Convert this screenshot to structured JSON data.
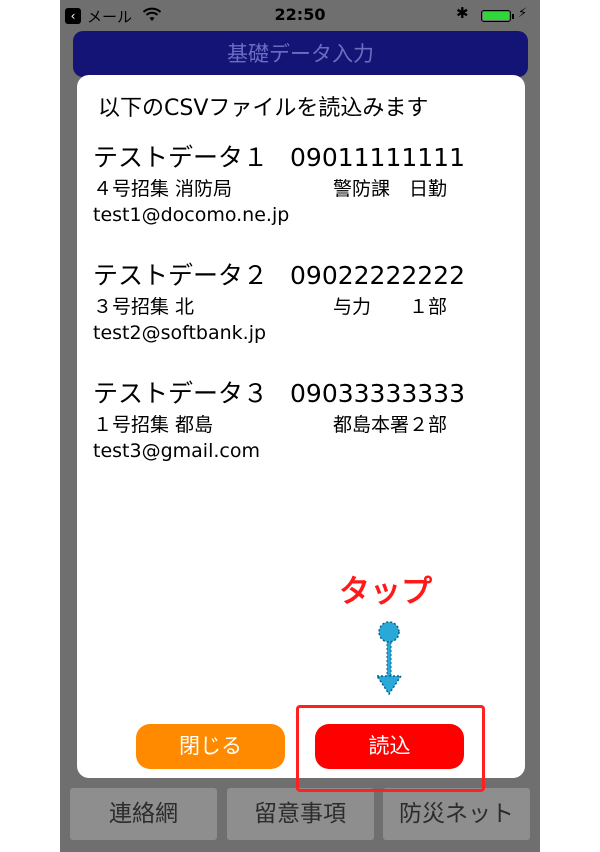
{
  "status_bar": {
    "back_glyph": "‹",
    "carrier": "メール",
    "time": "22:50",
    "bt_glyph": "✱",
    "charge_glyph": "⚡"
  },
  "app": {
    "title": "基礎データ入力",
    "bottom_tabs": [
      "連絡網",
      "留意事項",
      "防災ネット"
    ]
  },
  "dialog": {
    "title": "以下のCSVファイルを読込みます",
    "records": [
      {
        "name": "テストデータ１",
        "tel": "09011111111",
        "unit": "４号招集 消防局",
        "dept": "警防課　日勤",
        "email": "test1@docomo.ne.jp"
      },
      {
        "name": "テストデータ２",
        "tel": "09022222222",
        "unit": "３号招集 北",
        "dept": "与力　　１部",
        "email": "test2@softbank.jp"
      },
      {
        "name": "テストデータ３",
        "tel": "09033333333",
        "unit": "１号招集 都島",
        "dept": "都島本署２部",
        "email": "test3@gmail.com"
      }
    ],
    "close_label": "閉じる",
    "read_label": "読込"
  },
  "annotation": {
    "label": "タップ",
    "color": "#ff1a1a",
    "arrow_color": "#2aa8d8"
  },
  "colors": {
    "title_bar": "#141477",
    "close_button": "#ff8a00",
    "read_button": "#ff0000"
  }
}
